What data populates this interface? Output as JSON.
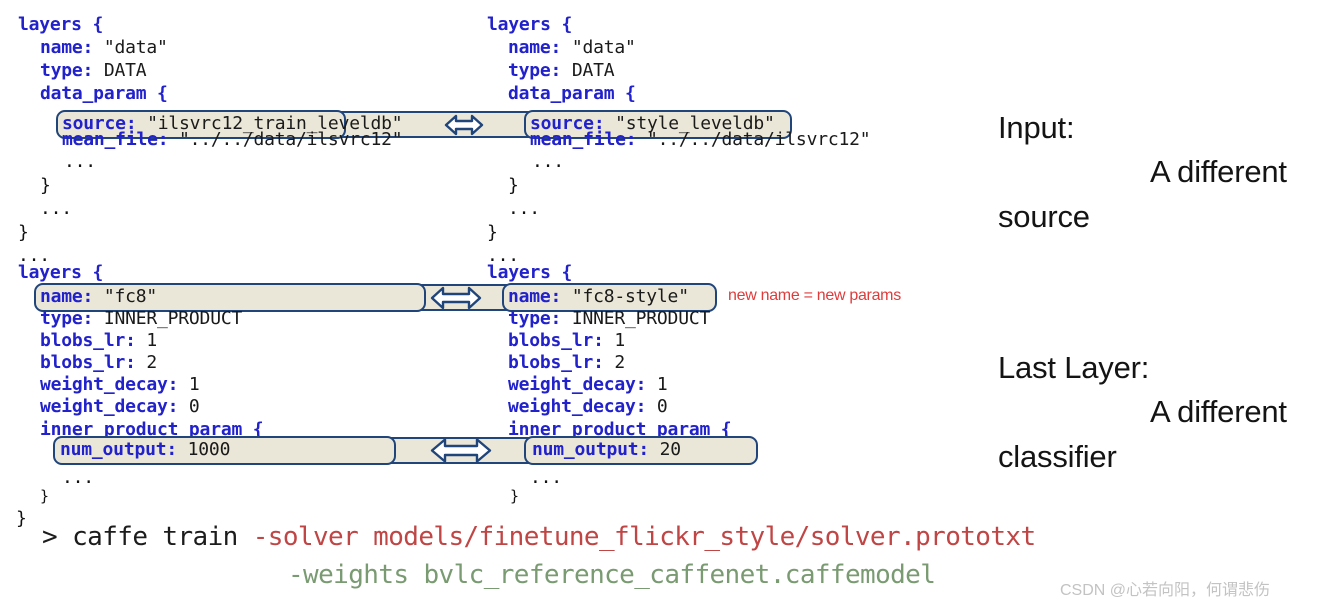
{
  "colors": {
    "key": "#2222cc",
    "value": "#1a1a1a",
    "highlight_border": "#20457a",
    "highlight_fill": "#eae7d8",
    "red_annotation": "#e03b3b",
    "cmd_red": "#c04545",
    "cmd_green": "#7a9b72",
    "watermark": "#c3c3c3"
  },
  "left_column": {
    "data_block": {
      "line1": "layers {",
      "line2_key": "name:",
      "line2_val": " \"data\"",
      "line3_key": "type:",
      "line3_val": " DATA",
      "line4_key": "data_param",
      "line4_val": " {",
      "highlight_key": "source:",
      "highlight_val": " \"ilsvrc12_train_leveldb\"",
      "line6_key": "mean_file:",
      "line6_val": " \"../../data/ilsvrc12\"",
      "dots_inner": "...",
      "close_inner": "}",
      "dots_outer": "...",
      "close_outer": "}"
    },
    "separator_dots": "...",
    "fc8_block": {
      "line1": "layers {",
      "highlight_name_key": "name:",
      "highlight_name_val": " \"fc8\"",
      "line3_key": "type:",
      "line3_val": " INNER_PRODUCT",
      "line4_key": "blobs_lr:",
      "line4_val": " 1",
      "line5_key": "blobs_lr:",
      "line5_val": " 2",
      "line6_key": "weight_decay:",
      "line6_val": " 1",
      "line7_key": "weight_decay:",
      "line7_val": " 0",
      "line8_key": "inner_product_param",
      "line8_val": " {",
      "highlight_num_key": "num_output:",
      "highlight_num_val": " 1000",
      "dots_inner": "...",
      "close_inner": "}",
      "close_outer": "}"
    }
  },
  "right_column": {
    "data_block": {
      "line1": "layers {",
      "line2_key": "name:",
      "line2_val": " \"data\"",
      "line3_key": "type:",
      "line3_val": " DATA",
      "line4_key": "data_param",
      "line4_val": " {",
      "highlight_key": "source:",
      "highlight_val": " \"style_leveldb\"",
      "line6_key": "mean_file:",
      "line6_val": " \"../../data/ilsvrc12\"",
      "dots_inner": "...",
      "close_inner": "}",
      "dots_outer": "...",
      "close_outer": "}"
    },
    "separator_dots": "...",
    "fc8_block": {
      "line1": "layers {",
      "highlight_name_key": "name:",
      "highlight_name_val": " \"fc8-style\"",
      "line3_key": "type:",
      "line3_val": " INNER_PRODUCT",
      "line4_key": "blobs_lr:",
      "line4_val": " 1",
      "line5_key": "blobs_lr:",
      "line5_val": " 2",
      "line6_key": "weight_decay:",
      "line6_val": " 1",
      "line7_key": "weight_decay:",
      "line7_val": " 0",
      "line8_key": "inner_product_param",
      "line8_val": " {",
      "highlight_num_key": "num_output:",
      "highlight_num_val": " 20",
      "dots_inner": "...",
      "close_inner": "}"
    }
  },
  "annotations": {
    "new_name_note": "new name = new params",
    "input_title": "Input:",
    "input_detail": "A different",
    "input_detail2": "source",
    "last_layer_title": "Last Layer:",
    "last_layer_detail": "A different",
    "last_layer_detail2": "classifier"
  },
  "command": {
    "line1_prompt": "> caffe train ",
    "line1_flag": "-solver models/finetune_flickr_style/solver.prototxt",
    "line2_flag": "-weights bvlc_reference_caffenet.caffemodel"
  },
  "watermark": {
    "text": "CSDN @心若向阳，何谓悲伤"
  }
}
